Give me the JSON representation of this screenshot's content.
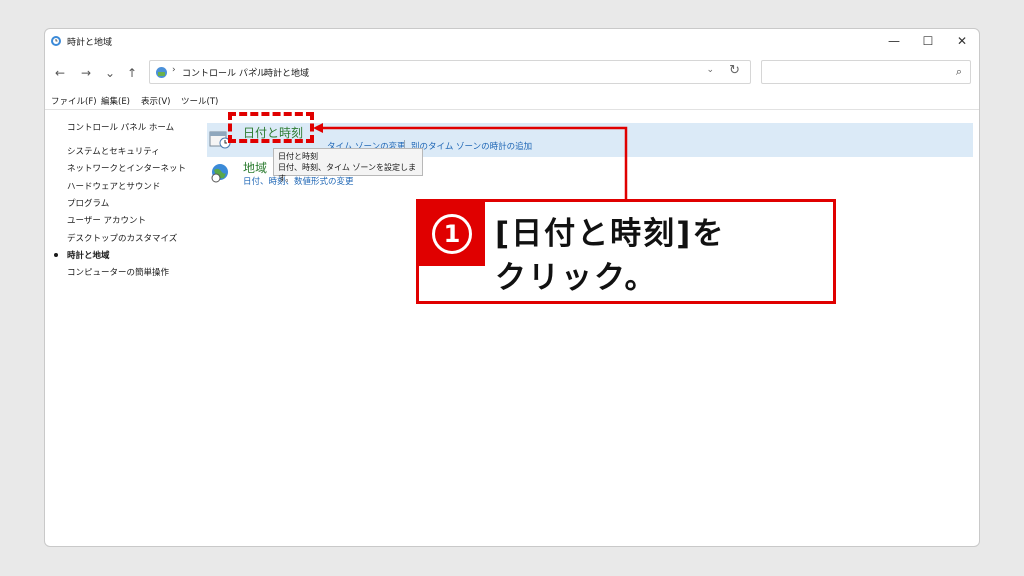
{
  "window": {
    "title": "時計と地域"
  },
  "title_controls": {
    "minimize": "—",
    "maximize": "☐",
    "close": "✕"
  },
  "nav": {
    "back": "←",
    "forward": "→",
    "recent": "⌄",
    "up": "↑"
  },
  "address": {
    "crumbs": [
      "コントロール パネル",
      "時計と地域"
    ],
    "separator": "›",
    "dropdown": "⌄",
    "refresh": "↻"
  },
  "search": {
    "placeholder": "",
    "icon": "search-icon"
  },
  "menubar": [
    "ファイル(F)",
    "編集(E)",
    "表示(V)",
    "ツール(T)"
  ],
  "sidebar": {
    "home": "コントロール パネル ホーム",
    "items": [
      "システムとセキュリティ",
      "ネットワークとインターネット",
      "ハードウェアとサウンド",
      "プログラム",
      "ユーザー アカウント",
      "デスクトップのカスタマイズ",
      "時計と地域",
      "コンピューターの簡単操作"
    ],
    "active_index": 6
  },
  "categories": {
    "datetime": {
      "title": "日付と時刻",
      "links": [
        "タイム ゾーンの変更",
        "別のタイム ゾーンの時計の追加"
      ]
    },
    "region": {
      "title": "地域",
      "links": "日付、時刻、数値形式の変更"
    }
  },
  "tooltip": {
    "title": "日付と時刻",
    "description": "日付、時刻、タイム ゾーンを設定します。"
  },
  "callout": {
    "number": "1",
    "line1": "[日付と時刻]を",
    "line2": "クリック。"
  },
  "colors": {
    "accent_red": "#e00000",
    "link_blue": "#1e66b5",
    "category_green": "#2e7d32",
    "highlight_row": "#dbeaf7"
  }
}
